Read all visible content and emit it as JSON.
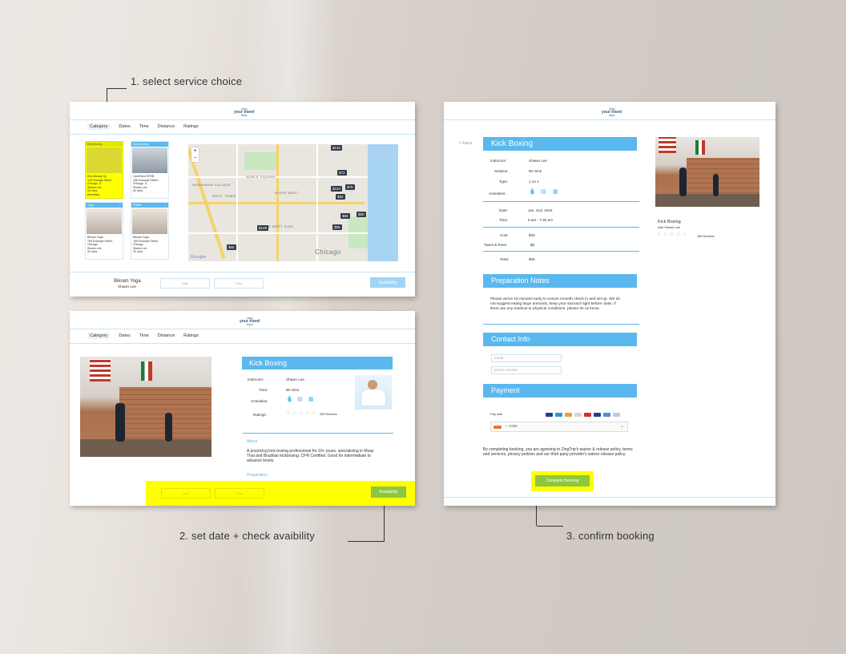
{
  "callouts": {
    "step1": "1. select service choice",
    "step2": "2. set date + check avaibility",
    "step3": "3. confirm booking"
  },
  "logo": {
    "line1": "zing",
    "line2": "your travel",
    "line3": "trips"
  },
  "nav": [
    "Category",
    "Dates",
    "Time",
    "Distance",
    "Ratings"
  ],
  "panel1": {
    "cards": [
      {
        "tag": "Kick Boxing",
        "name": "Kick Boxing Gy",
        "addr": "123 Chicago Street, Chicago, IL",
        "person": "Shawn Lee",
        "time": "90 mins",
        "reviews": "289 Reviews",
        "label": "Amenities",
        "highlight": true
      },
      {
        "tag": "Spin/Cycling",
        "name": "CycleSpot SPEB",
        "addr": "456 Example Street, Chicago, IL",
        "person": "Shawn Lee",
        "time": "60 mins",
        "reviews": "Free",
        "label": "Amenities",
        "highlight": false
      },
      {
        "tag": "Yoga",
        "name": "Bikram Yoga",
        "addr": "789 Example Street, Chicago",
        "person": "Shawn Lee",
        "time": "90 mins",
        "reviews": "289 Reviews",
        "label": "Amenities",
        "highlight": false
      },
      {
        "tag": "Pilates",
        "name": "Bikram Yoga",
        "addr": "789 Example Street, Chicago",
        "person": "Shawn Lee",
        "time": "90 mins",
        "reviews": "289 Reviews",
        "label": "Amenities",
        "highlight": false
      }
    ],
    "map": {
      "pins": [
        "$145",
        "$72",
        "$75",
        "$104",
        "$84",
        "$85",
        "$90",
        "$128",
        "$85",
        "$65"
      ],
      "labels": [
        "NOBLE SQUARE",
        "WEST TOWN",
        "NEAR WEST SIDE",
        "RIVER WEST",
        "UKRAINIAN VILLAGE",
        "Chicago",
        "Google"
      ]
    },
    "footer": {
      "title": "Bikram Yoga",
      "subtitle": "Shawn Lee",
      "date_placeholder": "Date",
      "time_placeholder": "Time",
      "button": "Availability"
    }
  },
  "panel2": {
    "title": "Kick Boxing",
    "rows": [
      {
        "label": "Instructor:",
        "value": "Shawn Lee"
      },
      {
        "label": "Time:",
        "value": "90 mins"
      },
      {
        "label": "Amenities:",
        "value": ""
      },
      {
        "label": "Ratings:",
        "value": "289 Reviews"
      }
    ],
    "about_heading": "About",
    "about_text": "A practicing kick boxing professional for 10+ years, specializing in Muay Thai and Brazilian kickboxing. CPR Certified. Good for intermediate to advance levels.",
    "prep_heading": "Preparation",
    "footer": {
      "date_placeholder": "Date",
      "time_placeholder": "Time",
      "button": "Availability"
    }
  },
  "panel3": {
    "back": "< back",
    "title": "Kick Boxing",
    "details": [
      {
        "label": "Instructor:",
        "value": "Shawn Lee"
      },
      {
        "label": "Session:",
        "value": "90 mins"
      },
      {
        "label": "Type:",
        "value": "1 on 1"
      },
      {
        "label": "Amenities:",
        "value": ""
      }
    ],
    "schedule": [
      {
        "label": "Date:",
        "value": "Jan. 2nd, 2019"
      },
      {
        "label": "Time:",
        "value": "6 am - 7:30 am"
      }
    ],
    "costs": [
      {
        "label": "Cost:",
        "value": "$30"
      },
      {
        "label": "Taxes & Fees:",
        "value": "$5"
      },
      {
        "label": "Total:",
        "value": "$35"
      }
    ],
    "prep_title": "Preparation Notes",
    "prep_text": "Please arrive 15 minutes early to ensure smooth check in and set up. We do not suggest eating large amounts, keep your stomach light before class. If there are any medical or physical conditions, please let us know.",
    "contact_title": "Contact Info",
    "email_placeholder": "email",
    "phone_placeholder": "phone number",
    "payment_title": "Payment",
    "pay_with": "Pay with",
    "card_select": "— 5485",
    "agreement": "By completing booking, you are agreeing to ZingTrip's waiver & release policy, terms and services, privacy policies and our third party provider's waiver release policy.",
    "complete_button": "Complete Booking",
    "side_title": "Kick Boxing",
    "side_subtitle": "with Shawn Lee",
    "side_reviews": "289 Reviews"
  },
  "colors": {
    "accent": "#5ab8ef",
    "highlight": "#ffff00",
    "confirm": "#8dc63f"
  }
}
